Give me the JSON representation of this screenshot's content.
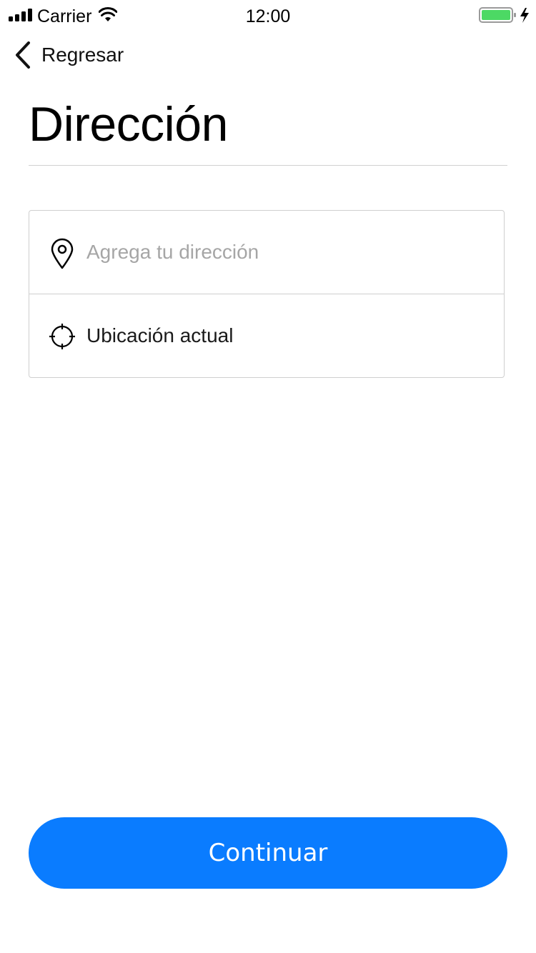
{
  "status_bar": {
    "carrier": "Carrier",
    "time": "12:00",
    "battery_color": "#4cd964"
  },
  "nav": {
    "back_label": "Regresar",
    "back_icon": "chevron-left-icon"
  },
  "header": {
    "title": "Dirección"
  },
  "address_card": {
    "address_placeholder": "Agrega tu dirección",
    "address_value": "",
    "address_icon": "location-pin-icon",
    "current_location_label": "Ubicación actual",
    "current_location_icon": "crosshair-icon"
  },
  "footer": {
    "continue_label": "Continuar",
    "accent_color": "#0a7cff"
  }
}
